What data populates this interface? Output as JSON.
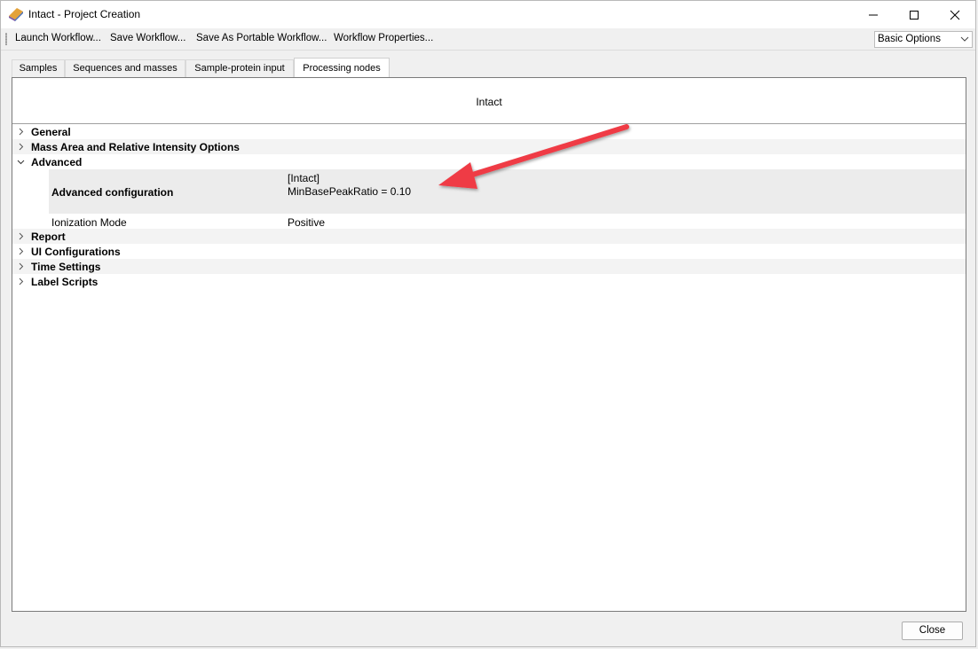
{
  "window": {
    "title": "Intact - Project Creation"
  },
  "toolbar": {
    "items": [
      "Launch Workflow...",
      "Save Workflow...",
      "Save As Portable Workflow...",
      "Workflow Properties..."
    ],
    "options_select": {
      "value": "Basic Options"
    }
  },
  "tabs": [
    {
      "label": "Samples",
      "active": false
    },
    {
      "label": "Sequences and masses",
      "active": false
    },
    {
      "label": "Sample-protein input",
      "active": false
    },
    {
      "label": "Processing nodes",
      "active": true
    }
  ],
  "panel": {
    "title": "Intact",
    "groups": [
      {
        "label": "General",
        "expanded": false
      },
      {
        "label": "Mass Area and Relative Intensity Options",
        "expanded": false
      },
      {
        "label": "Advanced",
        "expanded": true
      },
      {
        "label": "Report",
        "expanded": false
      },
      {
        "label": "UI Configurations",
        "expanded": false
      },
      {
        "label": "Time Settings",
        "expanded": false
      },
      {
        "label": "Label Scripts",
        "expanded": false
      }
    ],
    "advanced": {
      "config_name": "Advanced configuration",
      "config_value_line1": "[Intact]",
      "config_value_line2": "MinBasePeakRatio = 0.10",
      "ionization_name": "Ionization Mode",
      "ionization_value": "Positive"
    }
  },
  "footer": {
    "close_label": "Close"
  },
  "colors": {
    "annotation_arrow": "#ef3b45"
  }
}
